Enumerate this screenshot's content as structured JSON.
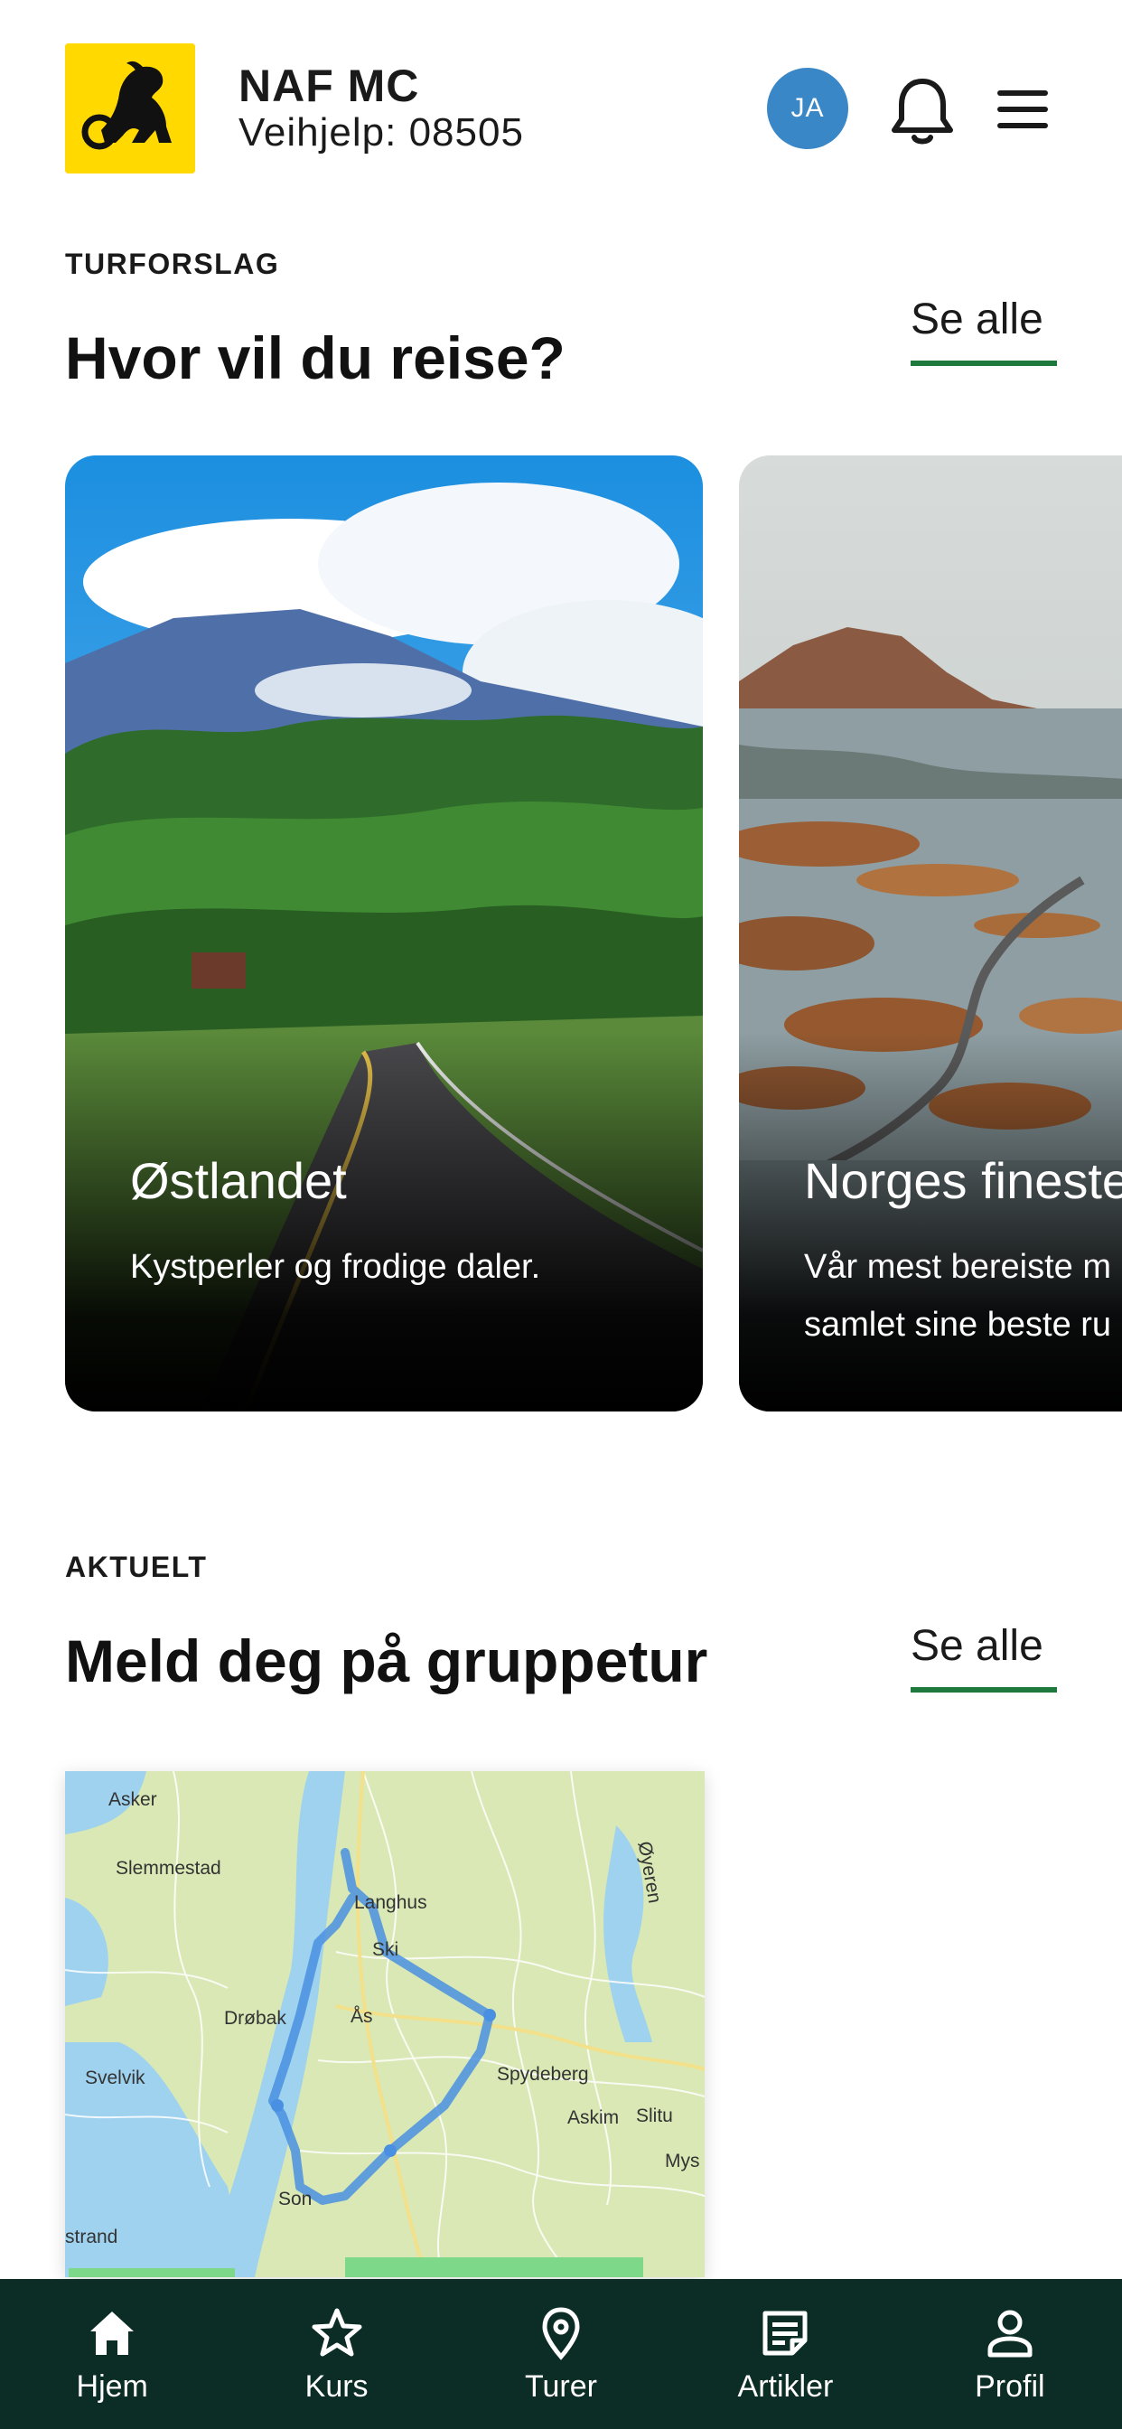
{
  "header": {
    "brand_title": "NAF MC",
    "brand_subtitle": "Veihjelp: 08505",
    "avatar_initials": "JA"
  },
  "turforslag": {
    "kicker": "TURFORSLAG",
    "title": "Hvor vil du reise?",
    "see_all": "Se alle",
    "cards": [
      {
        "title": "Østlandet",
        "description": "Kystperler og frodige daler."
      },
      {
        "title": "Norges fineste",
        "description": "Vår mest bereiste m samlet sine beste ru"
      }
    ]
  },
  "aktuelt": {
    "kicker": "AKTUELT",
    "title": "Meld deg på gruppetur",
    "see_all": "Se alle",
    "map_labels": [
      "Asker",
      "Slemmestad",
      "Langhus",
      "Ski",
      "Øyeren",
      "Drøbak",
      "Ås",
      "Svelvik",
      "Spydeberg",
      "Askim",
      "Slitu",
      "Mys",
      "Son",
      "strand"
    ]
  },
  "bottom_nav": [
    {
      "label": "Hjem",
      "icon": "home-icon"
    },
    {
      "label": "Kurs",
      "icon": "star-icon"
    },
    {
      "label": "Turer",
      "icon": "map-pin-icon"
    },
    {
      "label": "Artikler",
      "icon": "article-icon"
    },
    {
      "label": "Profil",
      "icon": "person-icon"
    }
  ],
  "colors": {
    "brand_yellow": "#ffd900",
    "accent_green": "#1e7a3c",
    "nav_background": "#0b2d26",
    "avatar_blue": "#3a87c8",
    "route_blue": "#4a90e2"
  }
}
